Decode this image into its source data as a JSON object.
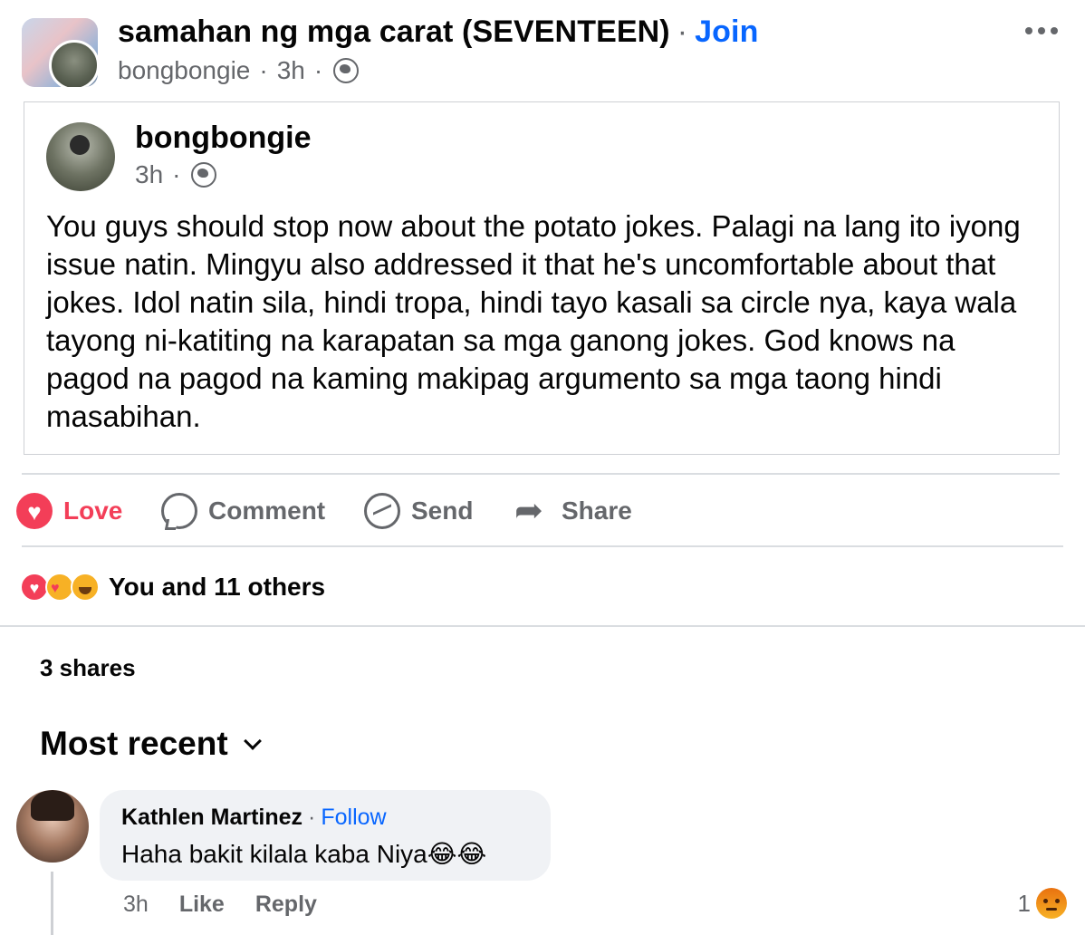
{
  "header": {
    "group_name": "samahan ng mga carat (SEVENTEEN)",
    "dot": "·",
    "join_label": "Join",
    "author": "bongbongie",
    "sep": "·",
    "time": "3h",
    "audience_icon": "globe-icon",
    "more_icon": "more-icon"
  },
  "shared_post": {
    "author": "bongbongie",
    "time": "3h",
    "sep": "·",
    "audience_icon": "globe-icon",
    "text": "You guys should stop now about the potato jokes. Palagi na lang ito iyong issue natin. Mingyu also addressed it that he's uncomfortable about that jokes. Idol natin sila, hindi tropa, hindi tayo kasali sa circle nya, kaya wala tayong ni-katiting na karapatan sa mga ganong jokes. God knows na pagod na pagod na kaming makipag argumento sa mga taong hindi masabihan."
  },
  "actions": {
    "love": "Love",
    "comment": "Comment",
    "send": "Send",
    "share": "Share"
  },
  "reactions": {
    "summary": "You and 11 others",
    "icons": [
      "love-icon",
      "care-icon",
      "haha-icon"
    ]
  },
  "shares": "3 shares",
  "sort": {
    "label": "Most recent"
  },
  "comment": {
    "author": "Kathlen Martinez",
    "dot": "·",
    "follow_label": "Follow",
    "text": "Haha bakit kilala kaba Niya😂😂",
    "time": "3h",
    "like_label": "Like",
    "reply_label": "Reply",
    "reaction_count": "1",
    "reaction_icon": "angry-icon"
  },
  "colors": {
    "accent": "#0866ff",
    "love": "#f33e58",
    "secondary_text": "#65676b",
    "bubble": "#f0f2f5"
  }
}
